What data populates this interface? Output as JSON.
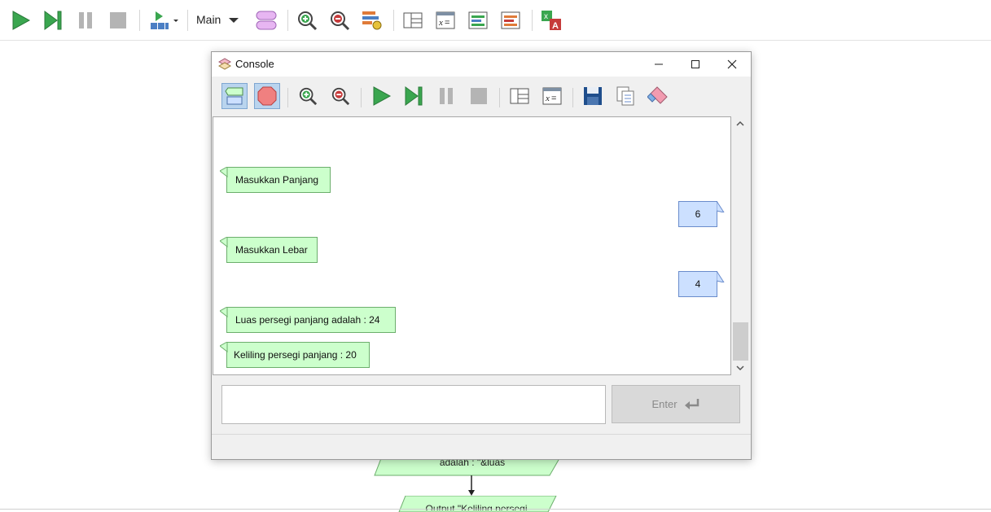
{
  "main_toolbar": {
    "function_selector": "Main"
  },
  "canvas": {
    "flow_text_1": "adalah : \"&luas",
    "flow_text_2": "Output \"Keliling persegi"
  },
  "console": {
    "title": "Console",
    "messages": [
      {
        "type": "output",
        "text": "Masukkan Panjang"
      },
      {
        "type": "input",
        "text": "6"
      },
      {
        "type": "output",
        "text": "Masukkan Lebar"
      },
      {
        "type": "input",
        "text": "4"
      },
      {
        "type": "output",
        "text": "Luas persegi panjang adalah : 24"
      },
      {
        "type": "output",
        "text": "Keliling persegi panjang : 20"
      }
    ],
    "input_value": "",
    "enter_label": "Enter"
  },
  "colors": {
    "output_bubble": "#ccffcc",
    "input_bubble": "#cce0ff",
    "play_green": "#3aa64f",
    "flow_shape": "#ccffcc"
  }
}
